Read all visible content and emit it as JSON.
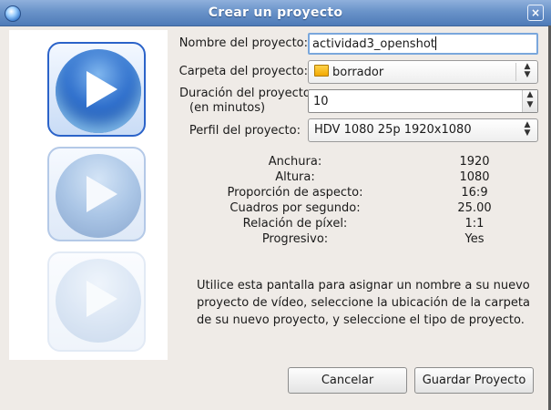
{
  "window": {
    "title": "Crear un proyecto",
    "close_glyph": "×"
  },
  "form": {
    "name_label": "Nombre del proyecto:",
    "name_value": "actividad3_openshot",
    "folder_label": "Carpeta del proyecto:",
    "folder_value": "borrador",
    "duration_label_line1": "Duración del proyecto",
    "duration_label_line2": "(en minutos)",
    "duration_value": "10",
    "profile_label": "Perfil del proyecto:",
    "profile_value": "HDV 1080 25p 1920x1080"
  },
  "profile_info": [
    {
      "key": "Anchura:",
      "value": "1920"
    },
    {
      "key": "Altura:",
      "value": "1080"
    },
    {
      "key": "Proporción de aspecto:",
      "value": "16:9"
    },
    {
      "key": "Cuadros por segundo:",
      "value": "25.00"
    },
    {
      "key": "Relación de píxel:",
      "value": "1:1"
    },
    {
      "key": "Progresivo:",
      "value": "Yes"
    }
  ],
  "description": "Utilice esta pantalla para asignar un nombre a su nuevo proyecto de vídeo, seleccione la ubicación de la carpeta de su nuevo proyecto, y seleccione el tipo de proyecto.",
  "buttons": {
    "cancel": "Cancelar",
    "save": "Guardar Proyecto"
  },
  "icons": {
    "app": "openshot-icon",
    "close": "close-icon",
    "folder": "folder-icon",
    "combo_arrows": "updown-arrows-icon",
    "artwork": "play-button-icon"
  },
  "colors": {
    "titlebar": "#6a93c9",
    "dialog_bg": "#efebe7",
    "focus_border": "#7aa7dc"
  }
}
